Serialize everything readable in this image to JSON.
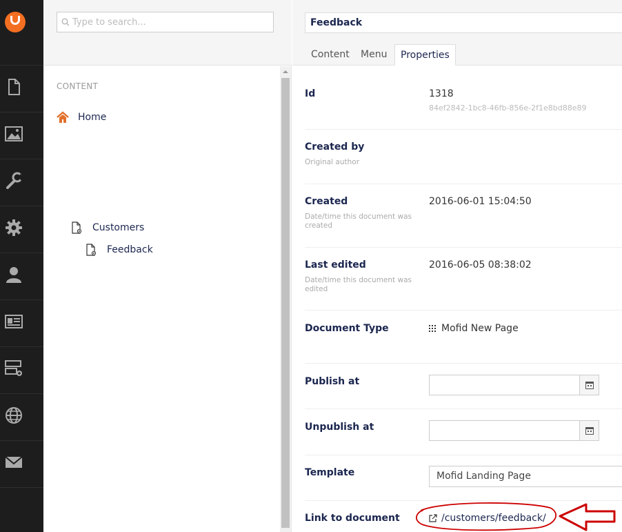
{
  "search": {
    "placeholder": "Type to search..."
  },
  "tree": {
    "section_title": "CONTENT",
    "nodes": [
      {
        "label": "Home",
        "icon": "home-icon"
      },
      {
        "label": "Customers",
        "icon": "document-icon"
      },
      {
        "label": "Feedback",
        "icon": "document-icon"
      }
    ]
  },
  "editor": {
    "name": "Feedback",
    "tabs": [
      {
        "label": "Content"
      },
      {
        "label": "Menu"
      },
      {
        "label": "Properties",
        "active": true
      }
    ],
    "properties": {
      "id": {
        "label": "Id",
        "value": "1318",
        "guid": "84ef2842-1bc8-46fb-856e-2f1e8bd88e89"
      },
      "created_by": {
        "label": "Created by",
        "desc": "Original author",
        "value": ""
      },
      "created": {
        "label": "Created",
        "desc": "Date/time this document was created",
        "value": "2016-06-01 15:04:50"
      },
      "last_edited": {
        "label": "Last edited",
        "desc": "Date/time this document was edited",
        "value": "2016-06-05 08:38:02"
      },
      "document_type": {
        "label": "Document Type",
        "value": "Mofid New Page"
      },
      "publish_at": {
        "label": "Publish at",
        "value": ""
      },
      "unpublish_at": {
        "label": "Unpublish at",
        "value": ""
      },
      "template": {
        "label": "Template",
        "value": "Mofid Landing Page"
      },
      "link": {
        "label": "Link to document",
        "value": "/customers/feedback/"
      }
    }
  },
  "colors": {
    "brand": "#f36f21",
    "rail": "#1d1d1d",
    "text": "#1b264f",
    "annotation": "#cc0000"
  }
}
